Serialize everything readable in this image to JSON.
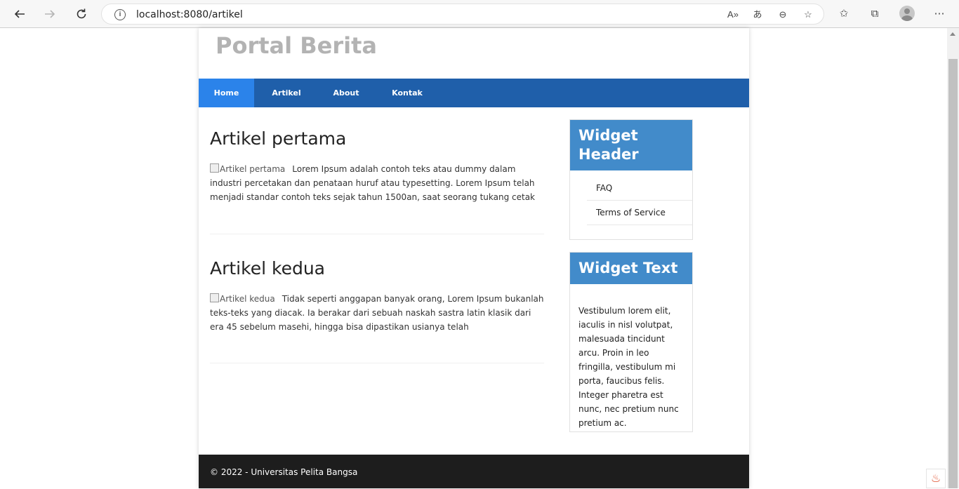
{
  "browser": {
    "url": "localhost:8080/artikel",
    "icons": [
      "back-icon",
      "forward-icon",
      "refresh-icon",
      "info-icon",
      "read-aloud-icon",
      "translate-icon",
      "zoom-out-icon",
      "add-favorite-icon",
      "favorites-icon",
      "collections-icon",
      "profile-icon",
      "more-icon"
    ]
  },
  "site": {
    "title": "Portal Berita"
  },
  "nav": {
    "items": [
      {
        "label": "Home"
      },
      {
        "label": "Artikel"
      },
      {
        "label": "About"
      },
      {
        "label": "Kontak"
      }
    ]
  },
  "articles": [
    {
      "title": "Artikel pertama",
      "img_alt": "Artikel pertama",
      "body": "Lorem Ipsum adalah contoh teks atau dummy dalam industri percetakan dan penataan huruf atau typesetting. Lorem Ipsum telah menjadi standar contoh teks sejak tahun 1500an, saat seorang tukang cetak"
    },
    {
      "title": "Artikel kedua",
      "img_alt": "Artikel kedua",
      "body": "Tidak seperti anggapan banyak orang, Lorem Ipsum bukanlah teks-teks yang diacak. Ia berakar dari sebuah naskah sastra latin klasik dari era 45 sebelum masehi, hingga bisa dipastikan usianya telah"
    }
  ],
  "sidebar": {
    "widget1": {
      "header": "Widget Header",
      "links": [
        "FAQ",
        "Terms of Service"
      ]
    },
    "widget2": {
      "header": "Widget Text",
      "body": "Vestibulum lorem elit, iaculis in nisl volutpat, malesuada tincidunt arcu. Proin in leo fringilla, vestibulum mi porta, faucibus felis. Integer pharetra est nunc, nec pretium nunc pretium ac."
    }
  },
  "footer": {
    "text": "© 2022 - Universitas Pelita Bangsa"
  },
  "colors": {
    "nav_bg": "#1f5faa",
    "nav_active": "#2b83ea",
    "widget_head": "#428bca",
    "footer_bg": "#1d1d1d"
  }
}
